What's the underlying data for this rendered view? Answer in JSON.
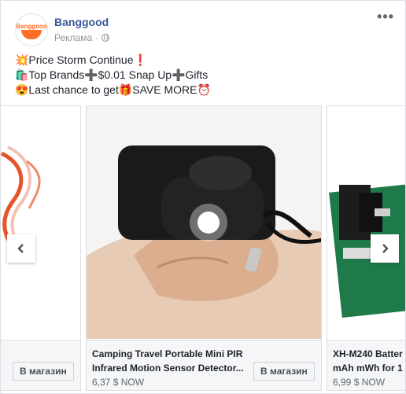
{
  "post": {
    "page_name": "Banggood",
    "avatar_text": "Banggood",
    "sponsored": "Реклама",
    "separator": "·",
    "more": "•••",
    "text_lines": [
      "💥Price Storm Continue❗",
      "🛍️Top Brands➕$0.01 Snap Up➕Gifts",
      "😍Last chance to get🎁SAVE MORE⏰"
    ]
  },
  "carousel": {
    "prev_label": "‹",
    "next_label": "›",
    "cards": [
      {
        "title": "",
        "subtitle": "",
        "price": "",
        "shop_label": "В магазин"
      },
      {
        "title": "Camping Travel Portable Mini PIR",
        "subtitle": "Infrared Motion Sensor Detector...",
        "price": "6,37 $ NOW",
        "shop_label": "В магазин"
      },
      {
        "title": "XH-M240 Batter",
        "subtitle": "mAh mWh for 1",
        "price": "6,99 $ NOW",
        "shop_label": ""
      }
    ]
  },
  "colors": {
    "link": "#385898",
    "brand_orange": "#ff6e26",
    "text": "#1d2129",
    "muted": "#90949c"
  }
}
